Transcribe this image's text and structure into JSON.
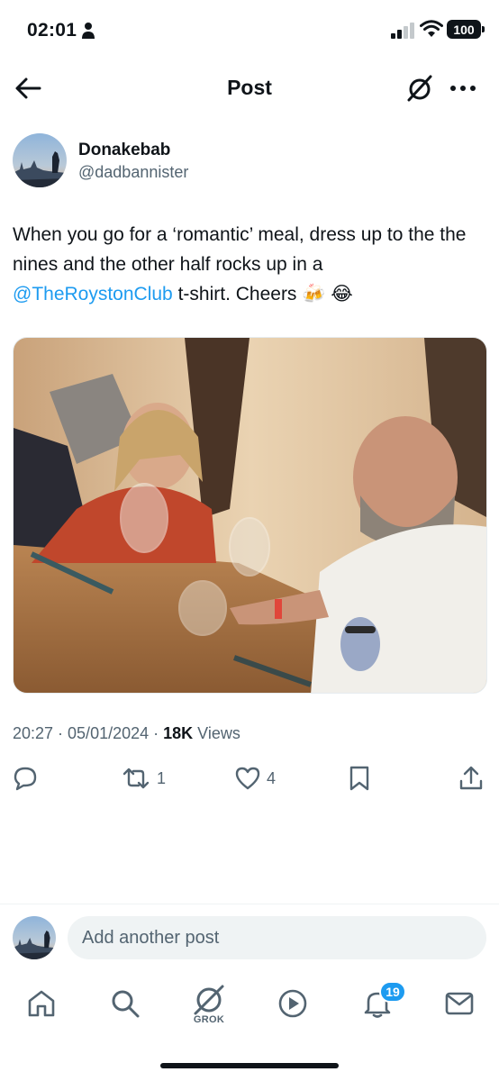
{
  "status_bar": {
    "time": "02:01",
    "battery": "100"
  },
  "header": {
    "title": "Post"
  },
  "author": {
    "name": "Donakebab",
    "handle": "@dadbannister"
  },
  "post": {
    "text_part1": "When you go for a ‘romantic’ meal, dress up to the the nines and the other half rocks up in a ",
    "mention": "@TheRoystonClub",
    "text_part2": "  t-shirt. Cheers 🍻 😂",
    "timestamp": "20:27 · 05/01/2024 · ",
    "views_count": "18K",
    "views_label": " Views"
  },
  "actions": {
    "reposts": "1",
    "likes": "4"
  },
  "reply": {
    "placeholder": "Add another post"
  },
  "tabbar": {
    "grok_label": "GROK",
    "notifications_badge": "19"
  },
  "colors": {
    "accent": "#1d9bf0",
    "secondary_text": "#536471",
    "primary_text": "#0f1419"
  }
}
